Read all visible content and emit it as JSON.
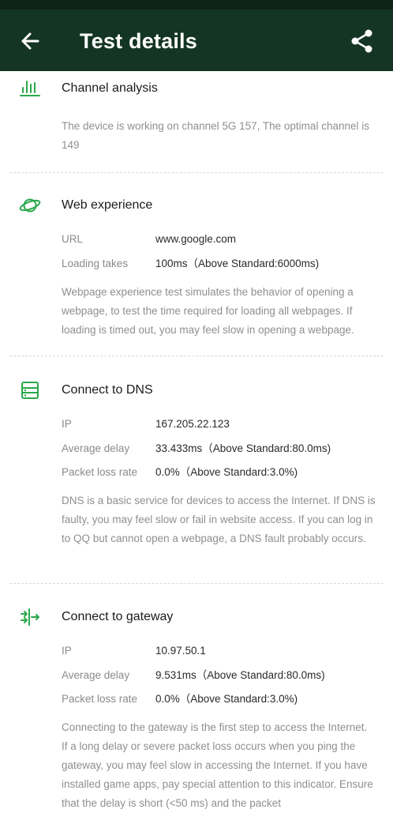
{
  "header": {
    "title": "Test details"
  },
  "sections": [
    {
      "title": "Channel analysis",
      "icon": "bar-chart-icon",
      "description": "The device is working on channel 5G 157, The optimal channel is 149"
    },
    {
      "title": "Web experience",
      "icon": "planet-icon",
      "rows": [
        {
          "label": "URL",
          "value": "www.google.com"
        },
        {
          "label": "Loading takes",
          "value": "100ms（Above Standard:6000ms)"
        }
      ],
      "description": "Webpage experience test simulates the behavior of opening a webpage, to test the time required for loading all webpages. If loading is timed out, you may feel slow in opening a webpage."
    },
    {
      "title": "Connect to DNS",
      "icon": "server-icon",
      "rows": [
        {
          "label": "IP",
          "value": "167.205.22.123"
        },
        {
          "label": "Average delay",
          "value": "33.433ms（Above Standard:80.0ms)"
        },
        {
          "label": "Packet loss rate",
          "value": "0.0%（Above Standard:3.0%)"
        }
      ],
      "description": "DNS is a basic service for devices to access the Internet. If DNS is faulty, you may feel slow or fail in website access. If you can log in to QQ but cannot open a webpage, a DNS fault probably occurs."
    },
    {
      "title": "Connect to gateway",
      "icon": "gateway-arrows-icon",
      "rows": [
        {
          "label": "IP",
          "value": "10.97.50.1"
        },
        {
          "label": "Average delay",
          "value": "9.531ms（Above Standard:80.0ms)"
        },
        {
          "label": "Packet loss rate",
          "value": "0.0%（Above Standard:3.0%)"
        }
      ],
      "description": "Connecting to the gateway is the first step to access the Internet. If a long delay or severe packet loss occurs when you ping the gateway, you may feel slow in accessing the Internet. If you have installed game apps, pay special attention to this indicator. Ensure that the delay is short (<50 ms) and the packet"
    }
  ],
  "colors": {
    "appbar": "#143524",
    "statusbar": "#0e2417",
    "accent": "#2aa84a"
  }
}
